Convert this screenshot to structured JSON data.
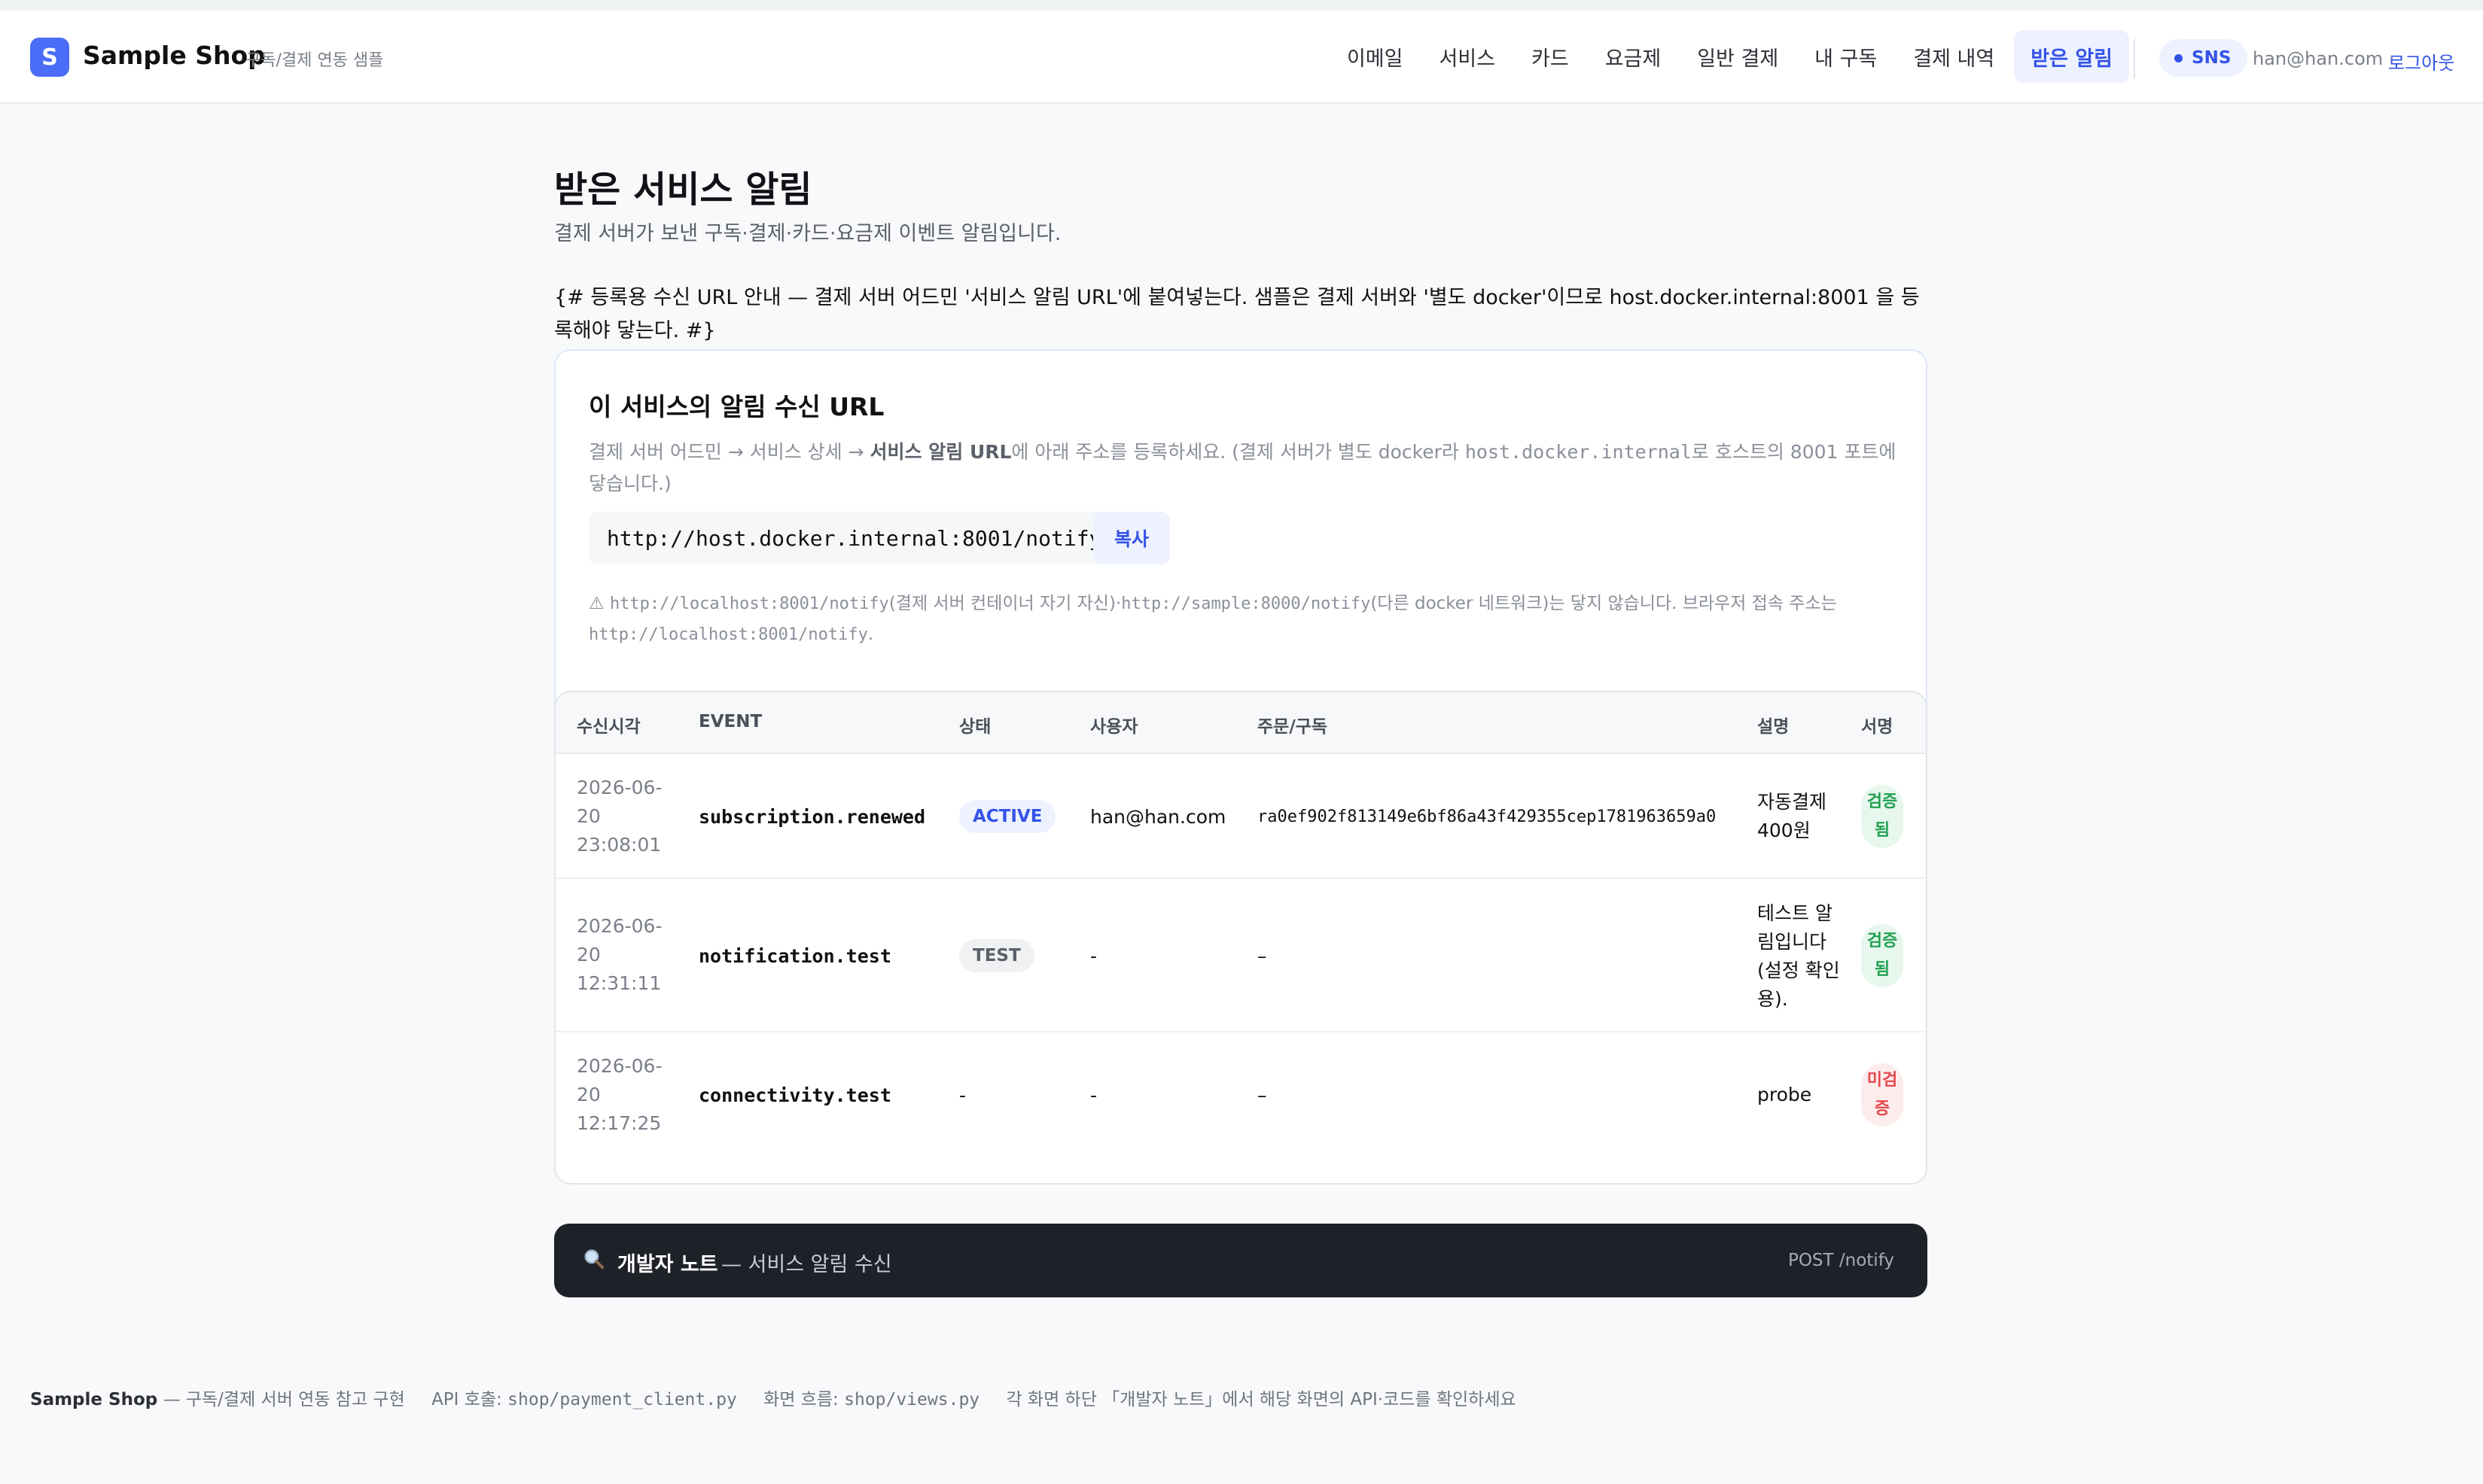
{
  "header": {
    "logo_letter": "S",
    "brand": "Sample Shop",
    "brand_sub": "구독/결제 연동 샘플",
    "nav": [
      "이메일",
      "서비스",
      "카드",
      "요금제",
      "일반 결제",
      "내 구독",
      "결제 내역",
      "받은 알림"
    ],
    "active_nav": "받은 알림",
    "sns_label": "SNS",
    "user_email": "han@han.com ·",
    "logout_label": "로그아웃"
  },
  "page": {
    "title": "받은 서비스 알림",
    "description": "결제 서버가 보낸 구독·결제·카드·요금제 이벤트 알림입니다.",
    "raw_comment": "{# 등록용 수신 URL 안내 — 결제 서버 어드민 '서비스 알림 URL'에 붙여넣는다. 샘플은 결제 서버와 '별도 docker'이므로 host.docker.internal:8001 을 등록해야 닿는다. #}"
  },
  "url_card": {
    "title": "이 서비스의 알림 수신 URL",
    "desc_prefix": "결제 서버 어드민 → 서비스 상세 → ",
    "desc_bold": "서비스 알림 URL",
    "desc_mid": "에 아래 주소를 등록하세요. (결제 서버가 별도 docker라 ",
    "desc_code": "host.docker.internal",
    "desc_suffix": "로 호스트의 8001 포트에 닿습니다.)",
    "url": "http://host.docker.internal:8001/notify",
    "copy_label": "복사",
    "warn_symbol": "⚠",
    "warn_code1": "http://localhost:8001/notify",
    "warn_text1": "(결제 서버 컨테이너 자기 자신)·",
    "warn_code2": "http://sample:8000/notify",
    "warn_text2": "(다른 docker 네트워크)는 닿지 않습니다. 브라우저 접속 주소는 ",
    "warn_code3": "http://localhost:8001/notify",
    "warn_end": "."
  },
  "table": {
    "columns": [
      "수신시각",
      "EVENT",
      "상태",
      "사용자",
      "주문/구독",
      "설명",
      "서명"
    ],
    "rows": [
      {
        "time": "2026-06-20 23:08:01",
        "event": "subscription.renewed",
        "status": "ACTIVE",
        "user": "han@han.com",
        "ref": "ra0ef902f813149e6bf86a43f429355cep1781963659a0",
        "desc": "자동결제 400원",
        "sign": "검증됨"
      },
      {
        "time": "2026-06-20 12:31:11",
        "event": "notification.test",
        "status": "TEST",
        "user": "-",
        "ref": "–",
        "desc": "테스트 알림입니다(설정 확인용).",
        "sign": "검증됨"
      },
      {
        "time": "2026-06-20 12:17:25",
        "event": "connectivity.test",
        "status": "-",
        "user": "-",
        "ref": "–",
        "desc": "probe",
        "sign": "미검증"
      }
    ]
  },
  "devnote": {
    "title": "개발자 노트",
    "subtitle": "— 서비스 알림 수신",
    "endpoint": "POST /notify"
  },
  "footer": {
    "brand": "Sample Shop",
    "brand_desc": "— 구독/결제 서버 연동 참고 구현",
    "api_label": "API 호출: ",
    "api_file": "shop/payment_client.py",
    "flow_label": "화면 흐름: ",
    "flow_file": "shop/views.py",
    "hint": "각 화면 하단 「개발자 노트」에서 해당 화면의 API·코드를 확인하세요"
  },
  "colors": {
    "accent": "#3453e6",
    "logo_bg": "#4a6cf7",
    "verified": "#22a052",
    "unverified": "#e5484d",
    "devnote_bg": "#1f2129"
  }
}
